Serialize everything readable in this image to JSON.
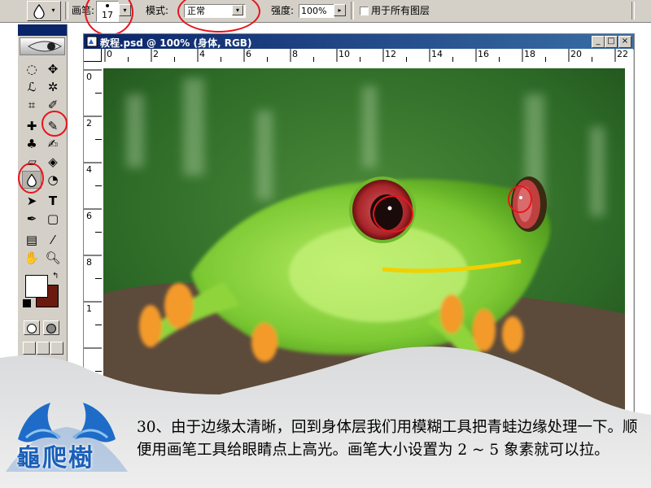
{
  "options_bar": {
    "brush_label": "画笔:",
    "brush_size": "17",
    "mode_label": "模式:",
    "mode_value": "正常",
    "strength_label": "强度:",
    "strength_value": "100%",
    "all_layers_label": "用于所有图层"
  },
  "document": {
    "title": "教程.psd @ 100% (身体, RGB)"
  },
  "ruler_top": [
    "0",
    "2",
    "4",
    "6",
    "8",
    "10",
    "12",
    "14",
    "16",
    "18",
    "20",
    "22"
  ],
  "ruler_left": [
    "0",
    "2",
    "4",
    "6",
    "8",
    "1"
  ],
  "logo": {
    "text": "龜爬樹"
  },
  "caption": {
    "text": "30、由于边缘太清晰，回到身体层我们用模糊工具把青蛙边缘处理一下。顺便用画笔工具给眼睛点上高光。画笔大小设置为 2 ~ 5 象素就可以拉。"
  },
  "colors": {
    "foreground": "#ffffff",
    "background": "#6b1a10",
    "annotation": "#e8141c",
    "titlebar": "#0a246a"
  },
  "icons": [
    "droplet-icon",
    "marquee-icon",
    "move-icon",
    "lasso-icon",
    "magic-wand-icon",
    "crop-icon",
    "slice-icon",
    "healing-icon",
    "brush-icon",
    "stamp-icon",
    "history-brush-icon",
    "eraser-icon",
    "fill-icon",
    "blur-icon",
    "dodge-icon",
    "path-select-icon",
    "type-icon",
    "pen-icon",
    "shape-icon",
    "notes-icon",
    "eyedropper-icon",
    "hand-icon",
    "zoom-icon"
  ]
}
